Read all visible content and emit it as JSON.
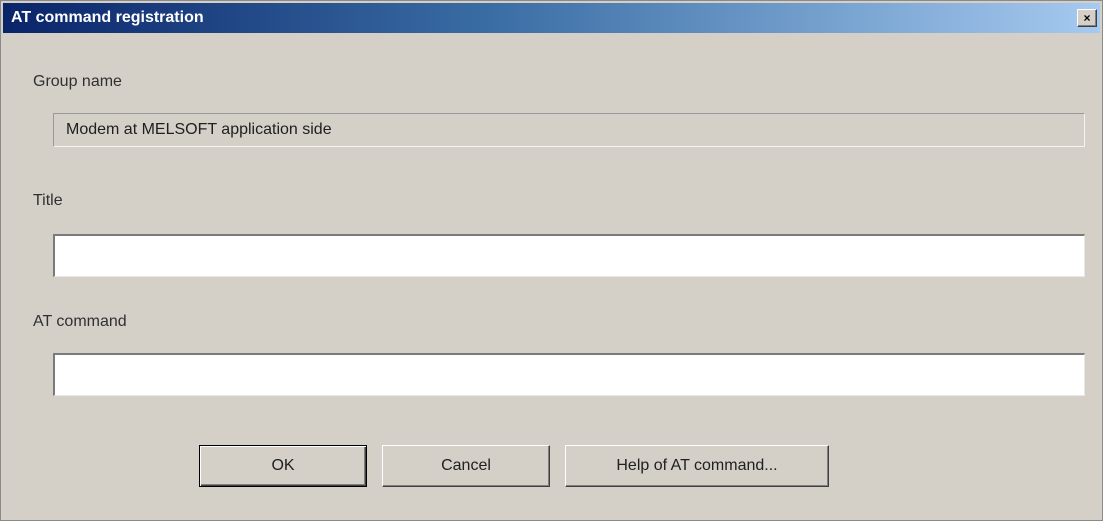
{
  "window": {
    "title": "AT command registration",
    "close_glyph": "×"
  },
  "group_name": {
    "label": "Group name",
    "value": "Modem at MELSOFT application side"
  },
  "title_field": {
    "label": "Title",
    "value": ""
  },
  "at_command_field": {
    "label": "AT command",
    "value": ""
  },
  "buttons": {
    "ok": "OK",
    "cancel": "Cancel",
    "help": "Help of AT command..."
  },
  "colors": {
    "dialog_bg": "#d4d0c8",
    "titlebar_start": "#0a246a",
    "titlebar_end": "#a6caf0"
  },
  "icons": {
    "close": "close-icon"
  }
}
